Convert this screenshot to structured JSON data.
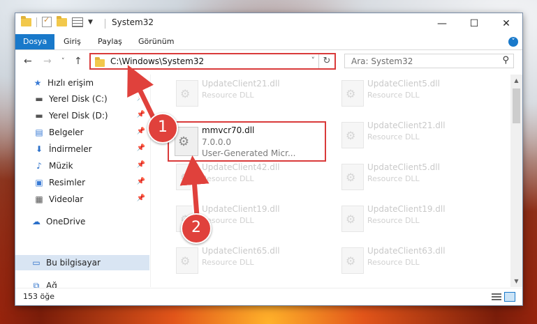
{
  "window": {
    "title": "System32"
  },
  "controls": {
    "minimize": "—",
    "maximize": "☐",
    "close": "✕"
  },
  "ribbon": {
    "tabs": [
      "Dosya",
      "Giriş",
      "Paylaş",
      "Görünüm"
    ]
  },
  "address": {
    "path": "C:\\Windows\\System32"
  },
  "search": {
    "placeholder": "Ara: System32"
  },
  "nav": {
    "items": [
      {
        "label": "Hızlı erişim",
        "icon": "star-icon",
        "pinned": false
      },
      {
        "label": "Yerel Disk (C:)",
        "icon": "drive-icon",
        "pinned": true
      },
      {
        "label": "Yerel Disk (D:)",
        "icon": "drive-icon",
        "pinned": true
      },
      {
        "label": "Belgeler",
        "icon": "documents-icon",
        "pinned": true
      },
      {
        "label": "İndirmeler",
        "icon": "download-icon",
        "pinned": true
      },
      {
        "label": "Müzik",
        "icon": "music-icon",
        "pinned": true
      },
      {
        "label": "Resimler",
        "icon": "pictures-icon",
        "pinned": true
      },
      {
        "label": "Videolar",
        "icon": "video-icon",
        "pinned": true
      },
      {
        "label": "OneDrive",
        "icon": "cloud-icon",
        "pinned": false
      },
      {
        "label": "Bu bilgisayar",
        "icon": "computer-icon",
        "pinned": false,
        "selected": true
      },
      {
        "label": "Ağ",
        "icon": "network-icon",
        "pinned": false
      }
    ]
  },
  "files": [
    {
      "name": "UpdateClient21.dll",
      "type": "Resource DLL"
    },
    {
      "name": "UpdateClient5.dll",
      "type": "Resource DLL"
    },
    {
      "name": "UpdateClient21.dll",
      "type": "Resource DLL"
    },
    {
      "name": "UpdateClient42.dll",
      "type": "Resource DLL"
    },
    {
      "name": "UpdateClient5.dll",
      "type": "Resource DLL"
    },
    {
      "name": "UpdateClient19.dll",
      "type": "Resource DLL"
    },
    {
      "name": "UpdateClient19.dll",
      "type": "Resource DLL"
    },
    {
      "name": "UpdateClient65.dll",
      "type": "Resource DLL"
    },
    {
      "name": "UpdateClient63.dll",
      "type": "Resource DLL"
    }
  ],
  "highlighted_file": {
    "name": "mmvcr70.dll",
    "version": "7.0.0.0",
    "description": "User-Generated Micr..."
  },
  "status": {
    "count": "153 öğe"
  },
  "callouts": [
    "1",
    "2"
  ],
  "colors": {
    "accent": "#1979ca",
    "highlight": "#d93a3a"
  }
}
